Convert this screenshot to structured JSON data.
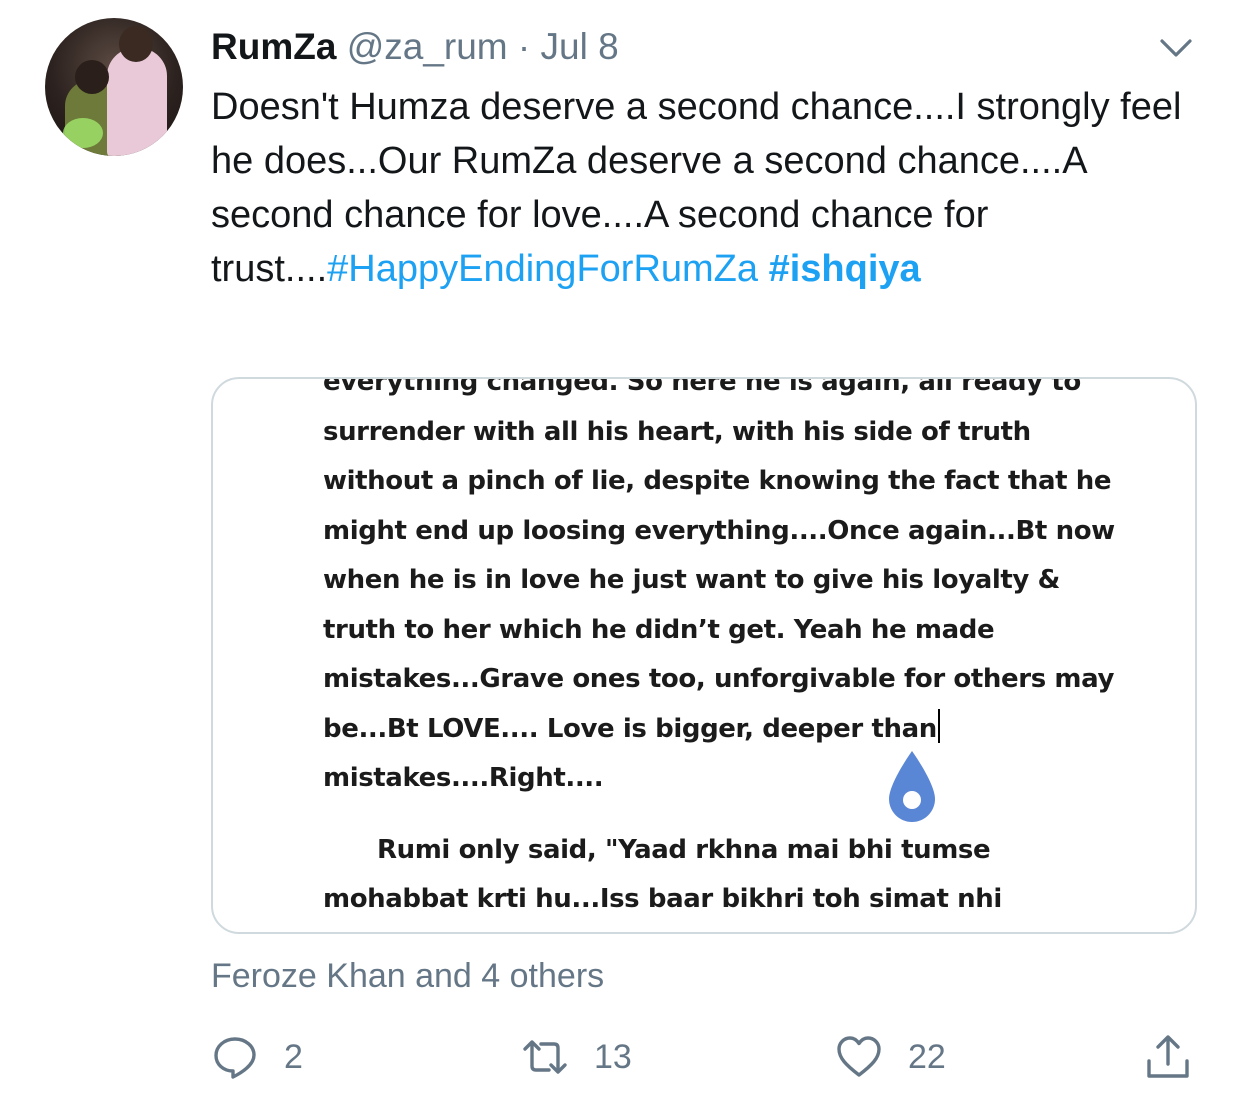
{
  "tweet": {
    "author_name": "RumZa",
    "author_handle": "@za_rum",
    "separator": "·",
    "date": "Jul 8",
    "text": "Doesn't Humza deserve a second chance....I strongly feel he does...Our RumZa deserve a second chance....A second chance for love....A second chance for trust....",
    "hashtags": [
      "#HappyEndingForRumZa",
      "#ishqiya"
    ],
    "liked_by": "Feroze Khan and 4 others"
  },
  "media": {
    "lines": [
      "everything changed. So here he is again, all ready to",
      "surrender with all his heart, with his side of truth",
      "without a pinch of lie, despite knowing the fact that he",
      "might end up loosing everything....Once again...Bt now",
      "when he is in love he just want to give his loyalty &",
      "truth to her which he didn’t get. Yeah he made",
      "mistakes...Grave ones too, unforgivable for others may",
      "be...Bt LOVE.... Love is bigger, deeper than",
      "mistakes....Right....",
      "Rumi only said, \"Yaad rkhna mai bhi tumse",
      "mohabbat krti hu...Iss baar bikhri toh simat nhi"
    ]
  },
  "actions": {
    "reply_count": "2",
    "retweet_count": "13",
    "like_count": "22"
  },
  "icons": {
    "menu": "chevron-down-icon",
    "reply": "reply-bubble-icon",
    "retweet": "retweet-icon",
    "like": "heart-icon",
    "share": "share-icon",
    "text_cursor_handle": "cursor-drop-icon"
  },
  "colors": {
    "hashtag": "#1da1f2",
    "secondary_text": "#657786",
    "cursor_handle": "#5a86d6"
  }
}
